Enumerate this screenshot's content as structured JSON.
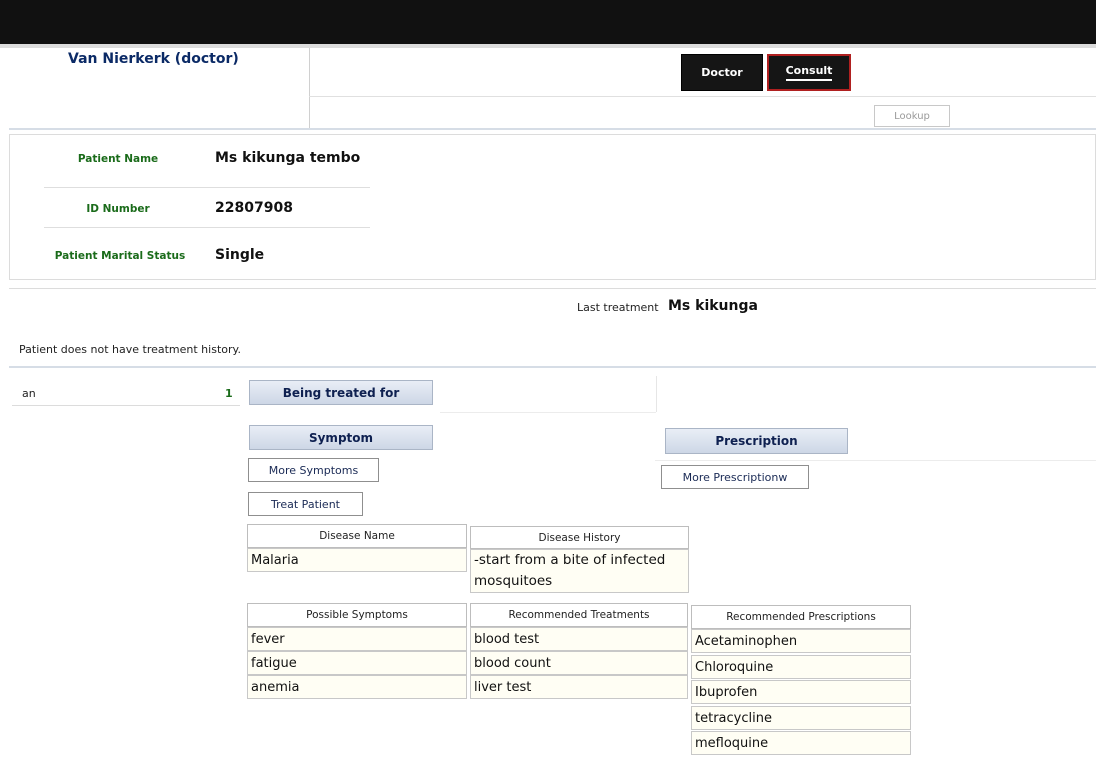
{
  "header": {
    "user_name": "Van Nierkerk (doctor)",
    "nav_doctor": "Doctor",
    "nav_consult": "Consult",
    "lookup_label": "Lookup"
  },
  "patient": {
    "name_label": "Patient Name",
    "name_value": "Ms kikunga tembo",
    "id_label": "ID Number",
    "id_value": "22807908",
    "marital_label": "Patient Marital Status",
    "marital_value": "Single"
  },
  "history": {
    "last_treatment_label": "Last treatment",
    "last_treatment_name": "Ms kikunga",
    "no_history_text": "Patient does not have treatment history."
  },
  "sidebar": {
    "item_label": "an",
    "item_count": "1"
  },
  "treatment": {
    "being_treated_label": "Being treated for",
    "symptom_label": "Symptom",
    "prescription_label": "Prescription",
    "more_symptoms_button": "More Symptoms",
    "treat_patient_button": "Treat Patient",
    "more_prescriptions_button": "More Prescriptionw"
  },
  "disease": {
    "name_header": "Disease Name",
    "name_value": "Malaria",
    "history_header": "Disease History",
    "history_value": "-start from a bite of infected mosquitoes"
  },
  "tables": {
    "symptoms_header": "Possible Symptoms",
    "symptoms": [
      "fever",
      "fatigue",
      "anemia"
    ],
    "treatments_header": "Recommended Treatments",
    "treatments": [
      "blood test",
      "blood count",
      "liver test"
    ],
    "prescriptions_header": "Recommended Prescriptions",
    "prescriptions": [
      "Acetaminophen",
      "Chloroquine",
      "Ibuprofen",
      "tetracycline",
      "mefloquine"
    ]
  },
  "colors": {
    "label_green": "#1a6b1a",
    "header_navy": "#0b2a66",
    "topbar": "#111111"
  }
}
